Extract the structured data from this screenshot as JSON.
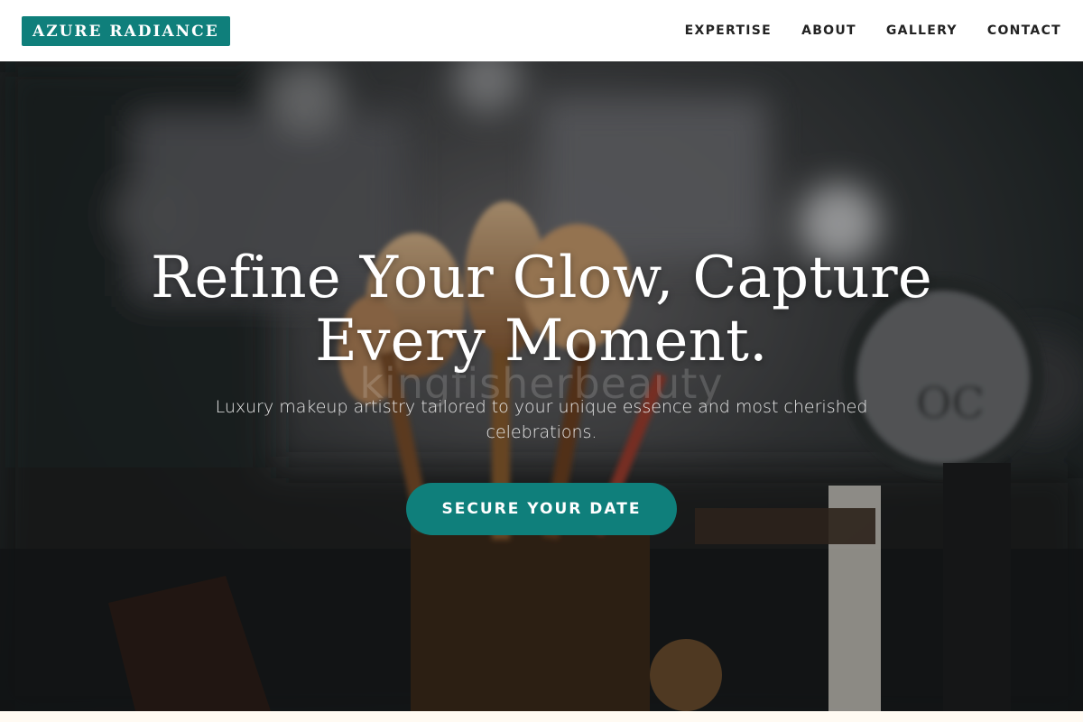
{
  "brand": {
    "logo_text": "AZURE RADIANCE"
  },
  "nav": {
    "items": [
      "EXPERTISE",
      "ABOUT",
      "GALLERY",
      "CONTACT"
    ]
  },
  "hero": {
    "title_line1": "Refine Your Glow, Capture",
    "title_line2": "Every Moment.",
    "subtitle": "Luxury makeup artistry tailored to your unique essence and most cherished celebrations.",
    "cta_label": "SECURE YOUR DATE",
    "watermark_text": "kingfisherbeauty"
  },
  "colors": {
    "accent": "#0f7f7b",
    "nav_bg": "#ffffff",
    "page_bg": "#fffaf2"
  },
  "icons": {
    "hero_image": "makeup-brushes-photo"
  }
}
